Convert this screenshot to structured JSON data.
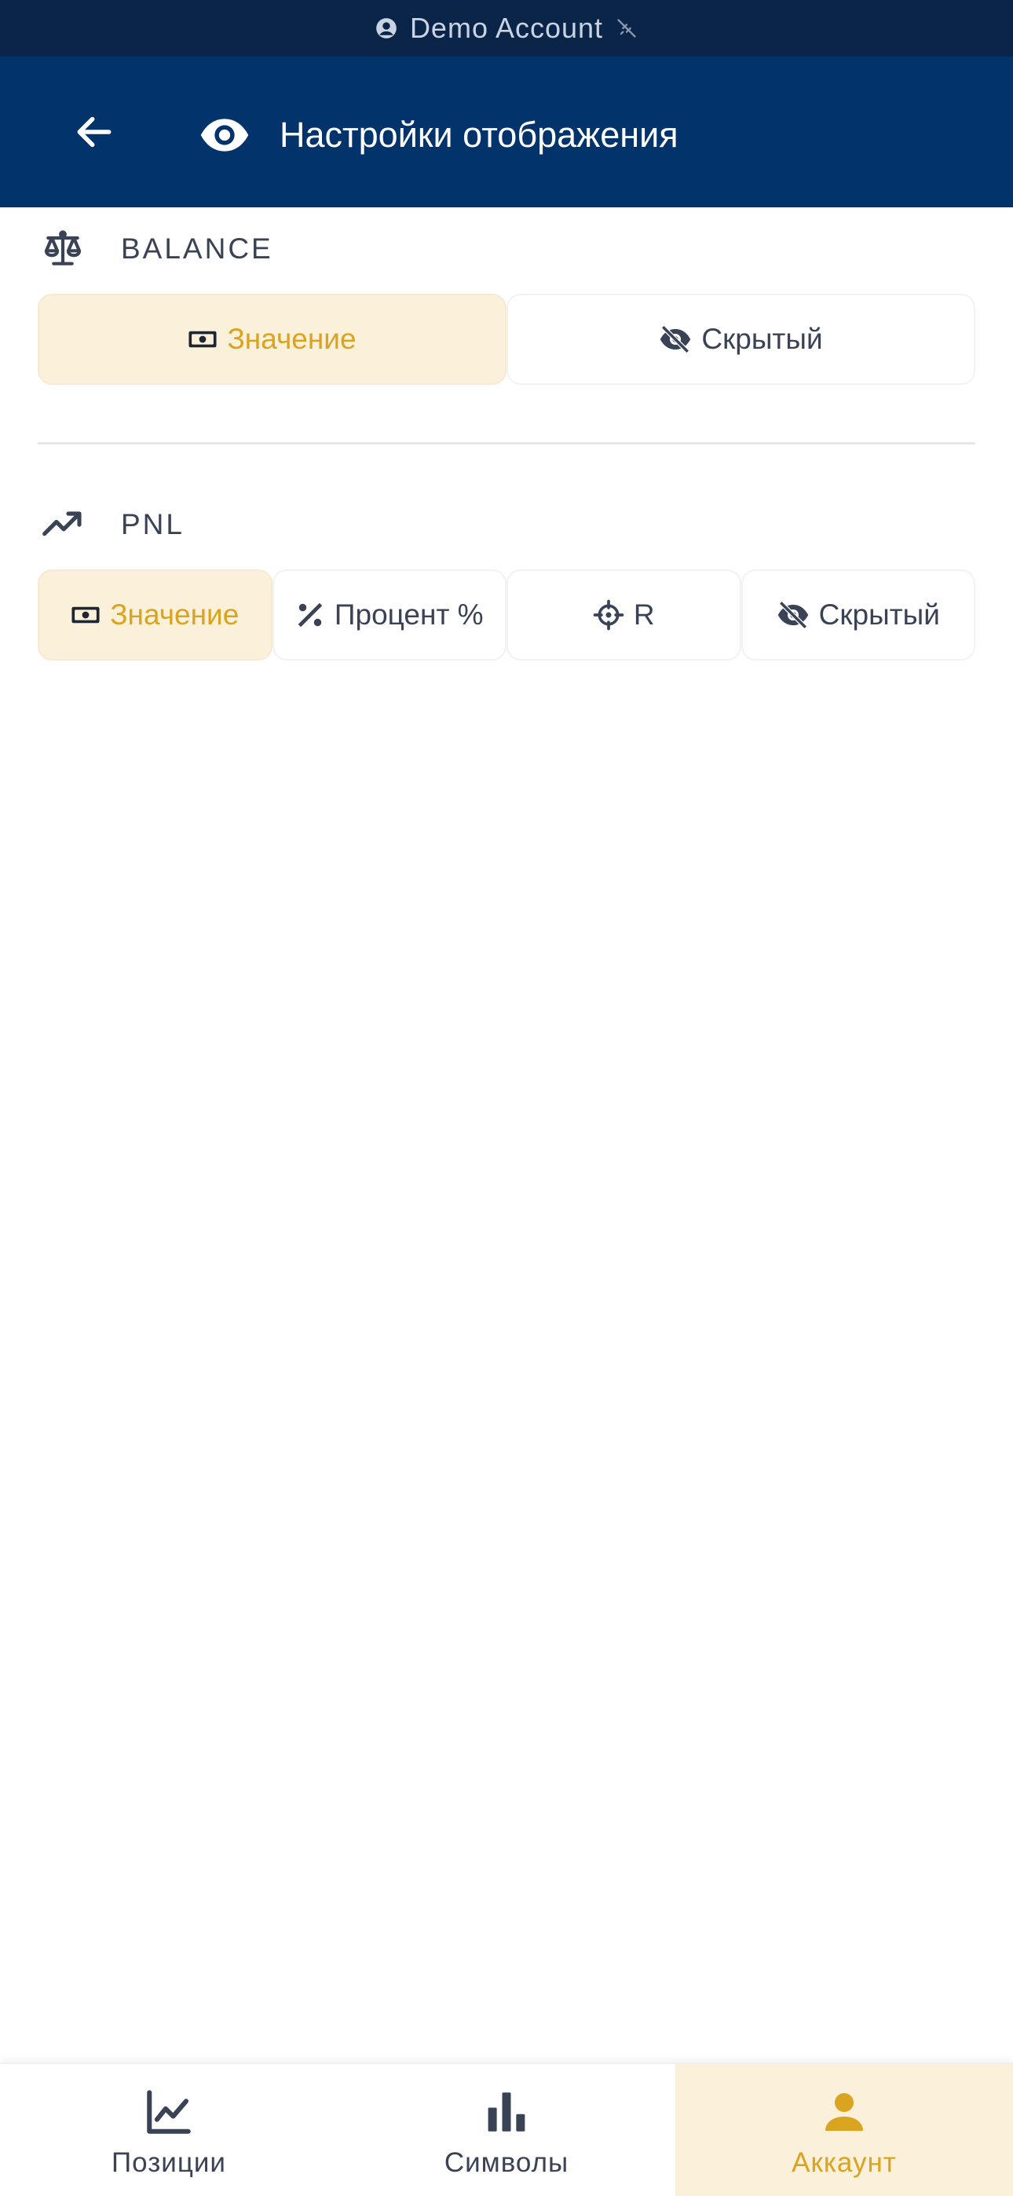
{
  "status_bar": {
    "account_label": "Demo Account"
  },
  "header": {
    "title": "Настройки отображения"
  },
  "balance_section": {
    "label": "BALANCE",
    "options": [
      {
        "label": "Значение",
        "icon": "banknote-icon",
        "selected": true
      },
      {
        "label": "Скрытый",
        "icon": "eye-off-icon",
        "selected": false
      }
    ]
  },
  "pnl_section": {
    "label": "PNL",
    "options": [
      {
        "label": "Значение",
        "icon": "banknote-icon",
        "selected": true
      },
      {
        "label": "Процент %",
        "icon": "percent-icon",
        "selected": false
      },
      {
        "label": "R",
        "icon": "crosshair-icon",
        "selected": false
      },
      {
        "label": "Скрытый",
        "icon": "eye-off-icon",
        "selected": false
      }
    ]
  },
  "bottom_nav": {
    "items": [
      {
        "label": "Позиции",
        "icon": "line-chart-icon",
        "active": false
      },
      {
        "label": "Символы",
        "icon": "bar-chart-icon",
        "active": false
      },
      {
        "label": "Аккаунт",
        "icon": "user-icon",
        "active": true
      }
    ]
  },
  "colors": {
    "status_bar_bg": "#0b2548",
    "header_bg": "#03336b",
    "accent": "#daa320",
    "accent_bg": "#fbf0d9",
    "text": "#3a4356"
  }
}
